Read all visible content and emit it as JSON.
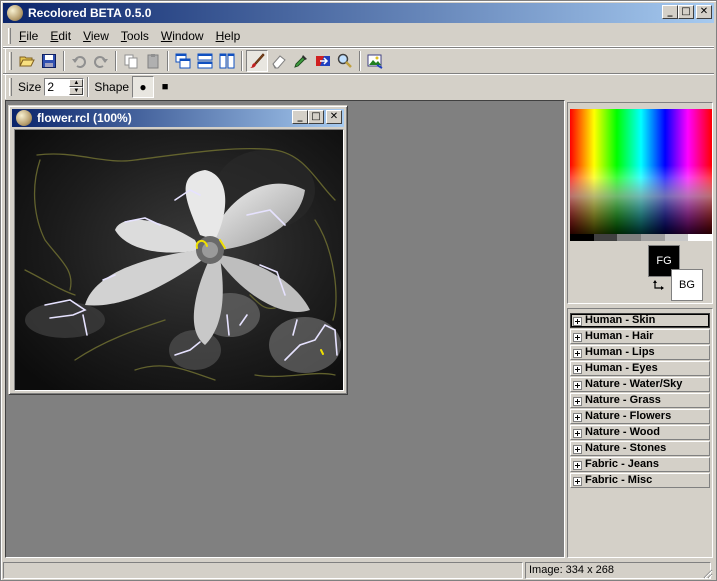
{
  "window": {
    "title": "Recolored BETA 0.5.0"
  },
  "menu": [
    {
      "pre": "",
      "ul": "F",
      "post": "ile"
    },
    {
      "pre": "",
      "ul": "E",
      "post": "dit"
    },
    {
      "pre": "",
      "ul": "V",
      "post": "iew"
    },
    {
      "pre": "",
      "ul": "T",
      "post": "ools"
    },
    {
      "pre": "",
      "ul": "W",
      "post": "indow"
    },
    {
      "pre": "",
      "ul": "H",
      "post": "elp"
    }
  ],
  "caption_glyphs": {
    "minimize": "_",
    "maximize": "□",
    "close": "✕"
  },
  "toolbar": {
    "size_label": "Size",
    "size_value": "2",
    "shape_label": "Shape",
    "shape_round_glyph": "●",
    "shape_square_glyph": "■"
  },
  "document": {
    "title": "flower.rcl (100%)"
  },
  "palette": {
    "fg_label": "FG",
    "bg_label": "BG",
    "fg_color": "#000000",
    "bg_color": "#ffffff",
    "gray_steps": [
      "#000000",
      "#404040",
      "#808080",
      "#a0a0a0",
      "#c8c8c8",
      "#ffffff"
    ]
  },
  "presets": [
    "Human - Skin",
    "Human - Hair",
    "Human - Lips",
    "Human - Eyes",
    "Nature - Water/Sky",
    "Nature - Grass",
    "Nature - Flowers",
    "Nature - Wood",
    "Nature - Stones",
    "Fabric - Jeans",
    "Fabric - Misc"
  ],
  "status": {
    "image_info": "Image: 334 x 268"
  }
}
